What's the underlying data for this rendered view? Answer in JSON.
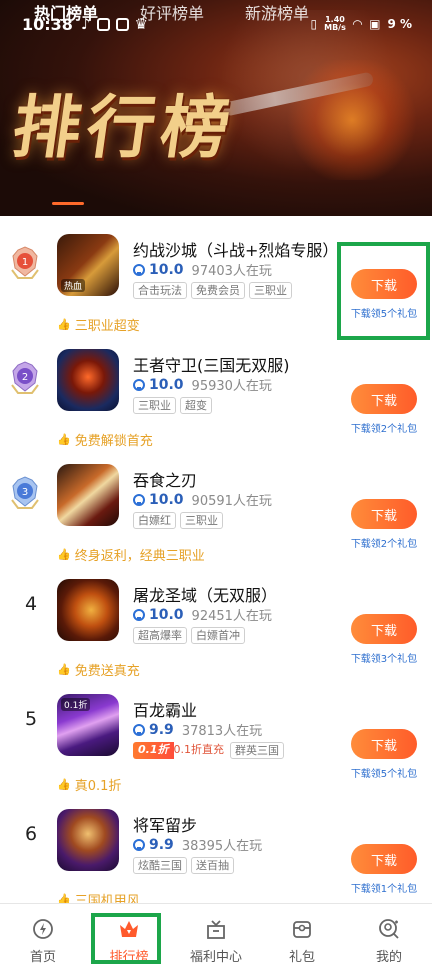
{
  "status_bar": {
    "time": "10:38",
    "net_speed_top": "1.40",
    "net_speed_bottom": "MB/s",
    "battery": "9 %"
  },
  "banner": {
    "title": "排行榜"
  },
  "tabs": [
    {
      "label": "热门榜单",
      "active": true
    },
    {
      "label": "好评榜单",
      "active": false
    },
    {
      "label": "新游榜单",
      "active": false
    }
  ],
  "list": [
    {
      "rank": "1",
      "name": "约战沙城（斗战+烈焰专服）",
      "score": "10.0",
      "players": "97403人在玩",
      "tags": [
        "合击玩法",
        "免费会员",
        "三职业"
      ],
      "highlight": "三职业超变",
      "button": "下载",
      "gift": "下载领5个礼包",
      "icon_label": "热血"
    },
    {
      "rank": "2",
      "name": "王者守卫(三国无双服)",
      "score": "10.0",
      "players": "95930人在玩",
      "tags": [
        "三职业",
        "超变"
      ],
      "highlight": "免费解锁首充",
      "button": "下载",
      "gift": "下载领2个礼包",
      "icon_label": ""
    },
    {
      "rank": "3",
      "name": "吞食之刃",
      "score": "10.0",
      "players": "90591人在玩",
      "tags": [
        "白嫖红",
        "三职业"
      ],
      "highlight": "终身返利，经典三职业",
      "button": "下载",
      "gift": "下载领2个礼包",
      "icon_label": ""
    },
    {
      "rank": "4",
      "name": "屠龙圣域（无双服）",
      "score": "10.0",
      "players": "92451人在玩",
      "tags": [
        "超高爆率",
        "白嫖首冲"
      ],
      "highlight": "免费送真充",
      "button": "下载",
      "gift": "下载领3个礼包",
      "icon_label": ""
    },
    {
      "rank": "5",
      "name": "百龙霸业",
      "score": "9.9",
      "players": "37813人在玩",
      "discount": "0.1折",
      "discount_text": "0.1折直充",
      "tags": [
        "群英三国"
      ],
      "highlight": "真0.1折",
      "button": "下载",
      "gift": "下载领5个礼包",
      "icon_label": "0.1折"
    },
    {
      "rank": "6",
      "name": "将军留步",
      "score": "9.9",
      "players": "38395人在玩",
      "tags": [
        "炫酷三国",
        "送百抽"
      ],
      "highlight": "三国机甲风",
      "button": "下载",
      "gift": "下载领1个礼包",
      "icon_label": ""
    }
  ],
  "bottom_nav": [
    {
      "label": "首页",
      "icon": "home-icon",
      "active": false
    },
    {
      "label": "排行榜",
      "icon": "crown-icon",
      "active": true
    },
    {
      "label": "福利中心",
      "icon": "gift-box-icon",
      "active": false
    },
    {
      "label": "礼包",
      "icon": "package-icon",
      "active": false
    },
    {
      "label": "我的",
      "icon": "profile-icon",
      "active": false
    }
  ],
  "colors": {
    "accent": "#ff5c2a",
    "score_blue": "#2b5fb8",
    "highlight_gold": "#e6a126",
    "annotation_green": "#1ca64a"
  }
}
